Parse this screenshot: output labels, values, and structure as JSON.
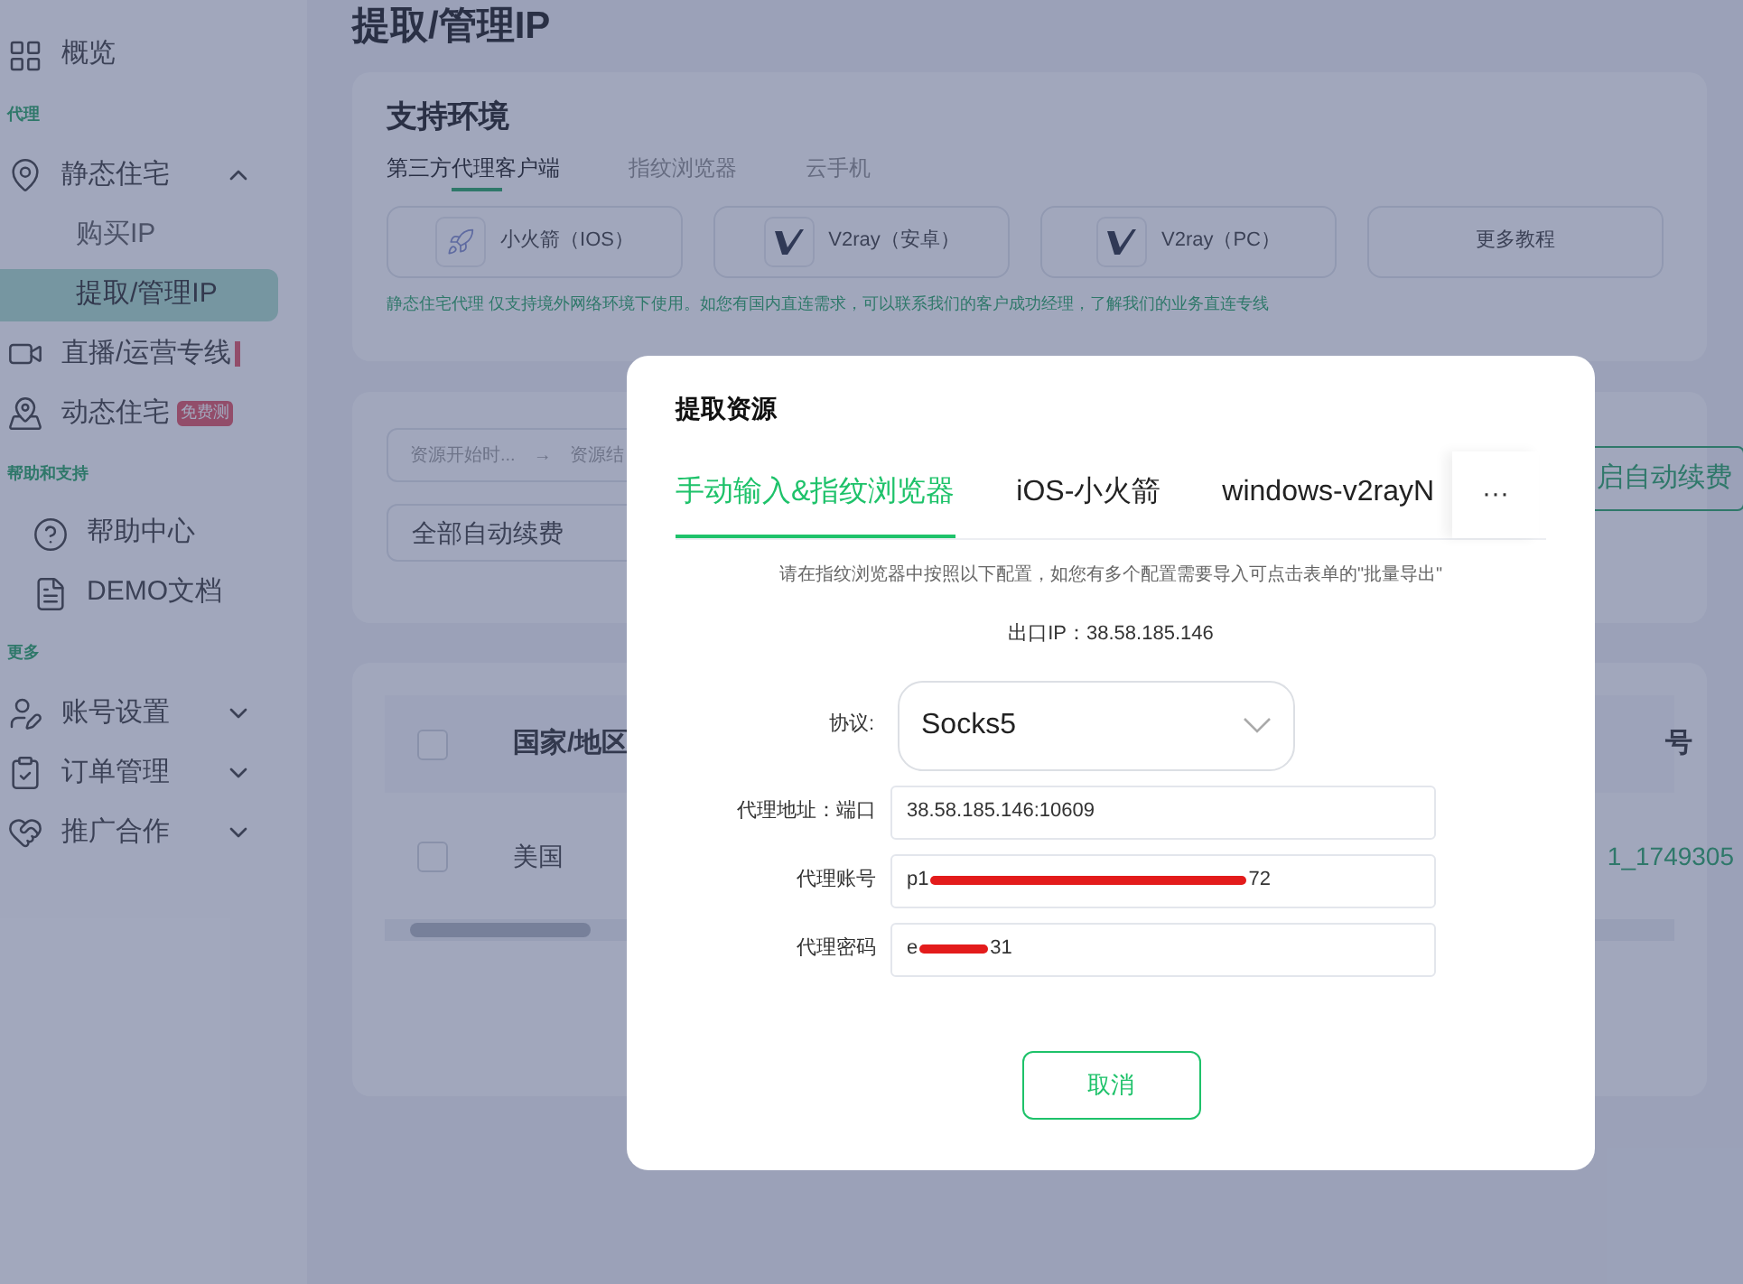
{
  "sidebar": {
    "items": [
      {
        "kind": "item",
        "label": "概览"
      },
      {
        "kind": "section",
        "label": "代理"
      },
      {
        "kind": "group",
        "label": "静态住宅",
        "expanded": true,
        "children": [
          {
            "label": "购买IP",
            "selected": false
          },
          {
            "label": "提取/管理IP",
            "selected": true
          }
        ]
      },
      {
        "kind": "item",
        "label": "直播/运营专线",
        "cut_badge": true
      },
      {
        "kind": "item",
        "label": "动态住宅",
        "badge": "免费测"
      },
      {
        "kind": "section",
        "label": "帮助和支持"
      },
      {
        "kind": "link",
        "label": "帮助中心"
      },
      {
        "kind": "link",
        "label": "DEMO文档"
      },
      {
        "kind": "section",
        "label": "更多"
      },
      {
        "kind": "group",
        "label": "账号设置",
        "expanded": false
      },
      {
        "kind": "group",
        "label": "订单管理",
        "expanded": false
      },
      {
        "kind": "group",
        "label": "推广合作",
        "expanded": false
      }
    ]
  },
  "page_title": "提取/管理IP",
  "env_card": {
    "title": "支持环境",
    "tabs": [
      {
        "label": "第三方代理客户端",
        "selected": true
      },
      {
        "label": "指纹浏览器",
        "selected": false
      },
      {
        "label": "云手机",
        "selected": false
      }
    ],
    "clients": [
      {
        "label": "小火箭（IOS）",
        "kind": "rocket"
      },
      {
        "label": "V2ray（安卓）",
        "kind": "v2ray"
      },
      {
        "label": "V2ray（PC）",
        "kind": "v2ray"
      },
      {
        "label": "更多教程",
        "kind": "text"
      }
    ],
    "note": "静态住宅代理 仅支持境外网络环境下使用。如您有国内直连需求，可以联系我们的客户成功经理，了解我们的业务直连专线"
  },
  "filter_card": {
    "date_start": "资源开始时...",
    "arrow": "→",
    "date_end": "资源结",
    "renew_select": "全部自动续费",
    "renew_button": "启自动续费"
  },
  "table": {
    "header_checked": false,
    "columns": [
      "国家/地区",
      "号"
    ],
    "rows": [
      {
        "country": "美国",
        "account": "1_1749305",
        "checked": false
      }
    ]
  },
  "modal": {
    "title": "提取资源",
    "tabs": [
      {
        "label": "手动输入&指纹浏览器",
        "selected": true
      },
      {
        "label": "iOS-小火箭",
        "selected": false
      },
      {
        "label": "windows-v2rayN",
        "selected": false
      }
    ],
    "more": "···",
    "hint": "请在指纹浏览器中按照以下配置，如您有多个配置需要导入可点击表单的\"批量导出\"",
    "exit_ip": "出口IP：38.58.185.146",
    "fields": [
      {
        "kind": "select",
        "label": "协议:",
        "value": "Socks5"
      },
      {
        "kind": "text",
        "label": "代理地址：端口",
        "value": "38.58.185.146:10609"
      },
      {
        "kind": "redacted",
        "label": "代理账号",
        "value_start": "p1",
        "value_end": "72"
      },
      {
        "kind": "redacted",
        "label": "代理密码",
        "value_start": "e",
        "value_end": "31"
      }
    ],
    "cancel": "取消"
  }
}
